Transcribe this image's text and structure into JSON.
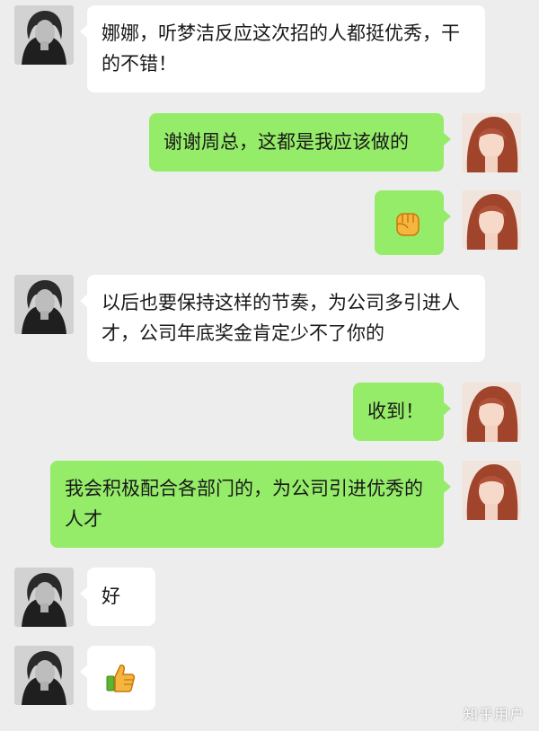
{
  "theme": {
    "background": "#ededed",
    "left_bubble": "#ffffff",
    "right_bubble": "#95ec69"
  },
  "messages": [
    {
      "side": "left",
      "sender": "boss",
      "text": "娜娜，听梦洁反应这次招的人都挺优秀，干的不错！"
    },
    {
      "side": "right",
      "sender": "me",
      "text": "谢谢周总，这都是我应该做的"
    },
    {
      "side": "right",
      "sender": "me",
      "emoji": "fist-emoji"
    },
    {
      "side": "left",
      "sender": "boss",
      "text": "以后也要保持这样的节奏，为公司多引进人才，公司年底奖金肯定少不了你的"
    },
    {
      "side": "right",
      "sender": "me",
      "text": "收到！"
    },
    {
      "side": "right",
      "sender": "me",
      "text": "我会积极配合各部门的，为公司引进优秀的人才"
    },
    {
      "side": "left",
      "sender": "boss",
      "text": "好"
    },
    {
      "side": "left",
      "sender": "boss",
      "emoji": "thumbs-up-emoji"
    }
  ],
  "watermark": "知乎用户"
}
